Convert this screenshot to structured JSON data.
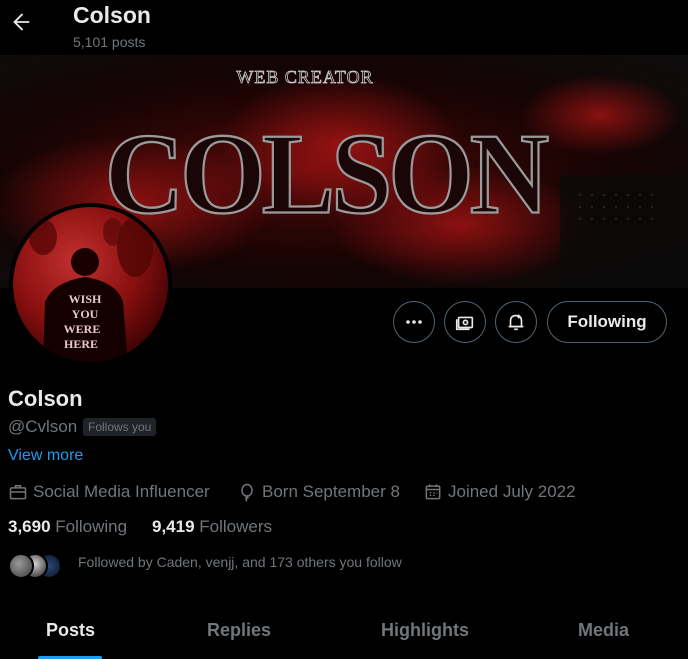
{
  "header": {
    "title": "Colson",
    "posts_count": "5,101 posts"
  },
  "banner": {
    "subtitle_text": "WEB CREATOR",
    "main_text": "COLSON"
  },
  "avatar": {
    "shirt_text": [
      "WISH",
      "YOU",
      "WERE",
      "HERE"
    ]
  },
  "actions": {
    "more_icon": "ellipsis-icon",
    "subscribe_icon": "money-icon",
    "notify_icon": "bell-icon",
    "following_label": "Following"
  },
  "profile": {
    "name": "Colson",
    "handle": "@Cvlson",
    "follows_you": "Follows you",
    "view_more": "View more",
    "category": "Social Media Influencer",
    "born": "Born September 8",
    "joined": "Joined July 2022",
    "following_count": "3,690",
    "following_label": "Following",
    "followers_count": "9,419",
    "followers_label": "Followers",
    "followed_by": "Followed by Caden, venjj, and 173 others you follow"
  },
  "tabs": [
    {
      "label": "Posts",
      "active": true
    },
    {
      "label": "Replies",
      "active": false
    },
    {
      "label": "Highlights",
      "active": false
    },
    {
      "label": "Media",
      "active": false
    }
  ],
  "colors": {
    "accent": "#1d9bf0",
    "text": "#e7e9ea",
    "muted": "#71767b",
    "border": "#536471",
    "banner_red": "#8b1010"
  }
}
